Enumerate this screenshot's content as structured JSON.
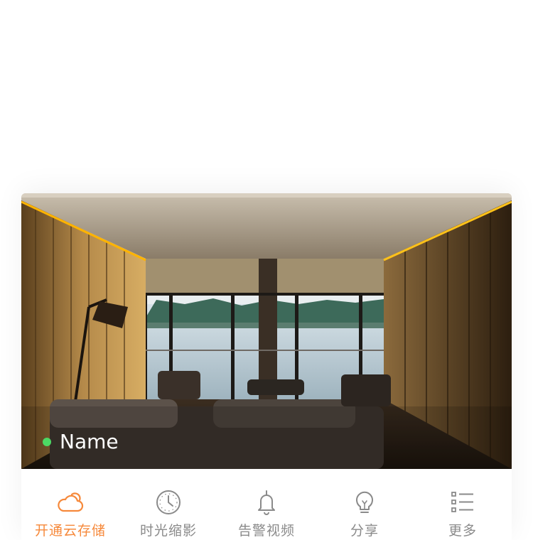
{
  "device": {
    "name": "Name",
    "status_color": "#4cd964"
  },
  "actions": [
    {
      "label": "开通云存储",
      "icon": "cloud-icon",
      "active": true
    },
    {
      "label": "时光缩影",
      "icon": "clock-icon",
      "active": false
    },
    {
      "label": "告警视频",
      "icon": "bell-icon",
      "active": false
    },
    {
      "label": "分享",
      "icon": "lightbulb-icon",
      "active": false
    },
    {
      "label": "更多",
      "icon": "list-icon",
      "active": false
    }
  ],
  "colors": {
    "accent": "#f6893b",
    "inactive": "#8a8a8a",
    "online": "#4cd964"
  }
}
